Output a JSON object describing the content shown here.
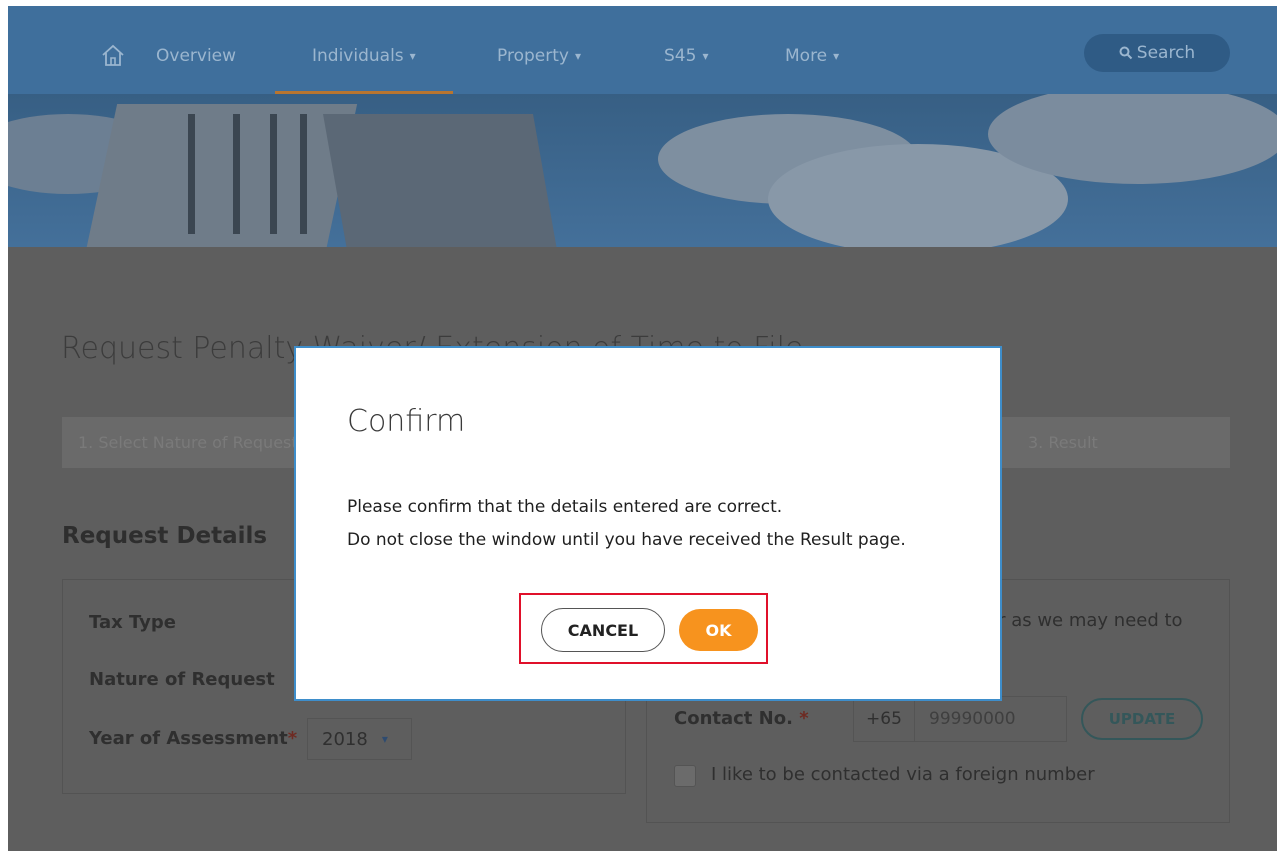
{
  "nav": {
    "items": [
      {
        "label": "Overview",
        "caret": ""
      },
      {
        "label": "Individuals",
        "caret": "▾"
      },
      {
        "label": "Property",
        "caret": "▾"
      },
      {
        "label": "S45",
        "caret": "▾"
      },
      {
        "label": "More",
        "caret": "▾"
      }
    ],
    "search_label": "Search"
  },
  "page": {
    "title": "Request Penalty Waiver/ Extension of Time to File",
    "steps": [
      "1. Select Nature of Request",
      "3. Result"
    ],
    "section_title": "Request Details",
    "left_card": {
      "tax_type_label": "Tax Type",
      "nature_label": "Nature of Request",
      "yoa_label": "Year of Assessment",
      "required_mark": "*",
      "yoa_value": "2018",
      "yoa_caret": "▾"
    },
    "right_card": {
      "note_text": "er as we may need to",
      "contact_label": "Contact No.",
      "required_mark": "*",
      "country_code": "+65",
      "phone_value": "99990000",
      "update_label": "UPDATE",
      "foreign_label": "I like to be contacted via a foreign number"
    }
  },
  "modal": {
    "title": "Confirm",
    "message_line1": "Please confirm that the details entered are correct.",
    "message_line2": "Do not close the window until you have received the Result page.",
    "cancel_label": "CANCEL",
    "ok_label": "OK"
  },
  "colors": {
    "nav_bg": "#3f6f9c",
    "modal_border": "#3e8ecb",
    "ok_button": "#f7931e",
    "highlight_box": "#e0102a"
  }
}
